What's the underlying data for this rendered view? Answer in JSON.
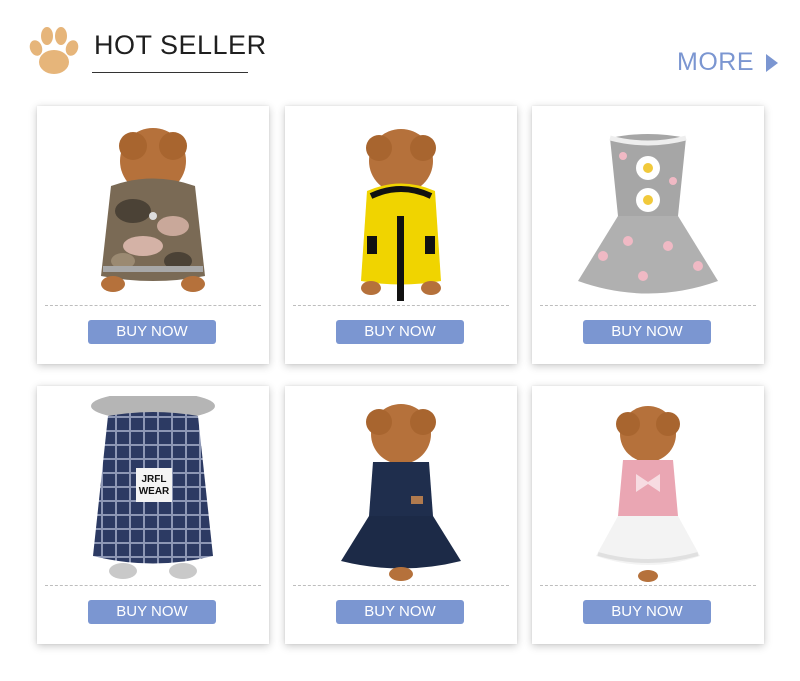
{
  "header": {
    "title": "HOT SELLER",
    "more_label": "MORE",
    "paw_icon": "paw-icon",
    "accent_color": "#7b96d1",
    "paw_color": "#e6b57a"
  },
  "products": [
    {
      "name": "camo-hoodie",
      "button": "BUY NOW"
    },
    {
      "name": "yellow-hoodie",
      "button": "BUY NOW"
    },
    {
      "name": "floral-dress-gray",
      "button": "BUY NOW"
    },
    {
      "name": "plaid-shirt-navy",
      "button": "BUY NOW"
    },
    {
      "name": "denim-dress",
      "button": "BUY NOW"
    },
    {
      "name": "pink-lace-dress",
      "button": "BUY NOW"
    }
  ],
  "badge_text": {
    "jrfl": "JRFL",
    "wear": "WEAR"
  }
}
